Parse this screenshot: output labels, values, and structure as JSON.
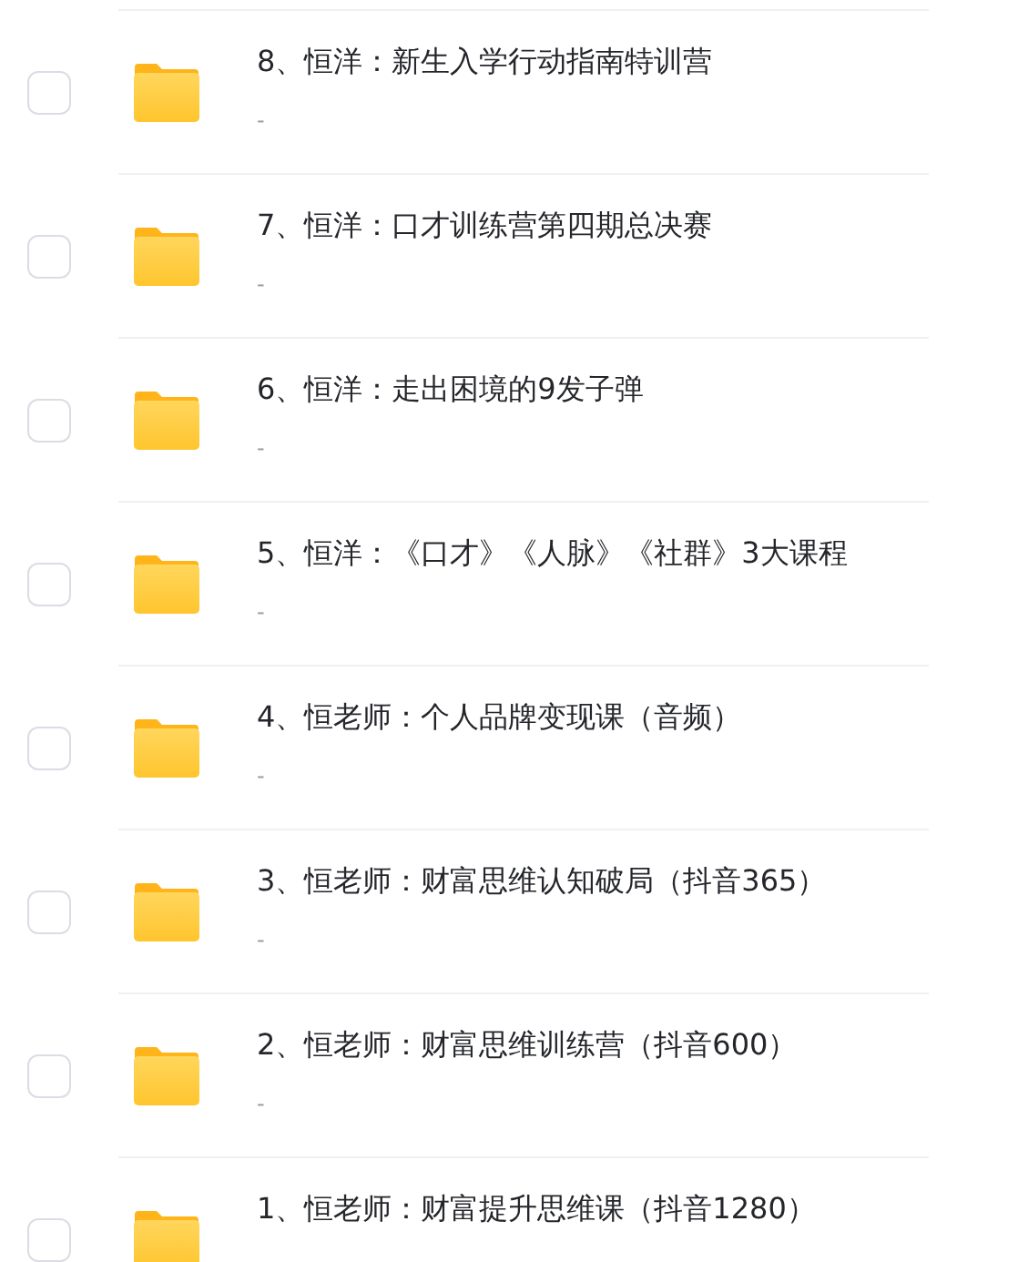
{
  "files": [
    {
      "title": "8、恒洋：新生入学行动指南特训营",
      "subtitle": "-",
      "checked": false
    },
    {
      "title": "7、恒洋：口才训练营第四期总决赛",
      "subtitle": "-",
      "checked": false
    },
    {
      "title": "6、恒洋：走出困境的9发子弹",
      "subtitle": "-",
      "checked": false
    },
    {
      "title": "5、恒洋：《口才》《人脉》《社群》3大课程",
      "subtitle": "-",
      "checked": false
    },
    {
      "title": "4、恒老师：个人品牌变现课（音频）",
      "subtitle": "-",
      "checked": false
    },
    {
      "title": "3、恒老师：财富思维认知破局（抖音365）",
      "subtitle": "-",
      "checked": false
    },
    {
      "title": "2、恒老师：财富思维训练营（抖音600）",
      "subtitle": "-",
      "checked": false
    },
    {
      "title": "1、恒老师：财富提升思维课（抖音1280）",
      "checked": false
    }
  ]
}
